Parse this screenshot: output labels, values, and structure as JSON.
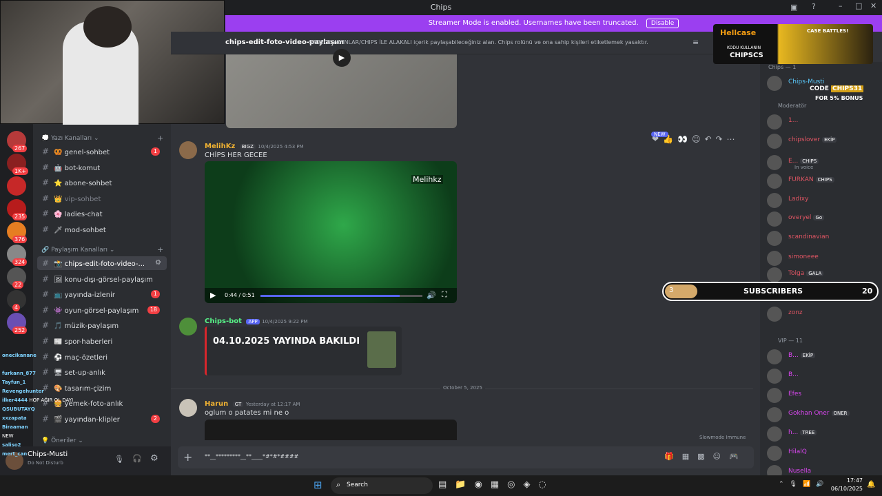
{
  "window": {
    "title": "Chips"
  },
  "banner": {
    "text": "Streamer Mode is enabled. Usernames have been truncated.",
    "button": "Disable"
  },
  "channel": {
    "name": "chips-edit-foto-video-paylaşım",
    "topic": "SADECE YAYINLAR/CHIPS İLE ALAKALI içerik paylaşabileceğiniz alan. Chips rolünü ve ona sahip kişileri etiketlemek yasaktır."
  },
  "servers": [
    {
      "badge": "267"
    },
    {
      "badge": "1K+"
    },
    {
      "badge": ""
    },
    {
      "badge": "235"
    },
    {
      "badge": "376"
    },
    {
      "badge": "324"
    },
    {
      "badge": "22"
    },
    {
      "badge": "4"
    },
    {
      "badge": "252"
    }
  ],
  "categories": {
    "text": "Yazı Kanalları",
    "share": "Paylaşım Kanalları",
    "suggest": "Öneriler"
  },
  "channels": [
    {
      "name": "genel-sohbet",
      "icon": "🥨",
      "badge": "1",
      "muted": false,
      "selected": false
    },
    {
      "name": "bot-komut",
      "icon": "🤖",
      "badge": "",
      "muted": false,
      "selected": false
    },
    {
      "name": "abone-sohbet",
      "icon": "⭐",
      "badge": "",
      "muted": false,
      "selected": false
    },
    {
      "name": "vip-sohbet",
      "icon": "👑",
      "badge": "",
      "muted": true,
      "selected": false
    },
    {
      "name": "ladies-chat",
      "icon": "🌸",
      "badge": "",
      "muted": false,
      "selected": false
    },
    {
      "name": "mod-sohbet",
      "icon": "🗡",
      "badge": "",
      "muted": false,
      "selected": false
    },
    {
      "name": "chips-edit-foto-video-...",
      "icon": "📸",
      "badge": "",
      "muted": false,
      "selected": true
    },
    {
      "name": "konu-dışı-görsel-paylaşım",
      "icon": "🖼",
      "badge": "",
      "muted": false,
      "selected": false
    },
    {
      "name": "yayında-izlenir",
      "icon": "📺",
      "badge": "1",
      "muted": false,
      "selected": false
    },
    {
      "name": "oyun-görsel-paylaşım",
      "icon": "👾",
      "badge": "18",
      "muted": false,
      "selected": false
    },
    {
      "name": "müzik-paylaşım",
      "icon": "🎵",
      "badge": "",
      "muted": false,
      "selected": false
    },
    {
      "name": "spor-haberleri",
      "icon": "📰",
      "badge": "",
      "muted": false,
      "selected": false
    },
    {
      "name": "maç-özetleri",
      "icon": "⚽",
      "badge": "",
      "muted": false,
      "selected": false
    },
    {
      "name": "set-up-anlık",
      "icon": "🖥",
      "badge": "",
      "muted": false,
      "selected": false
    },
    {
      "name": "tasarım-çizim",
      "icon": "🎨",
      "badge": "",
      "muted": false,
      "selected": false
    },
    {
      "name": "yemek-foto-anlık",
      "icon": "🍔",
      "badge": "",
      "muted": false,
      "selected": false
    },
    {
      "name": "yayından-klipler",
      "icon": "🎬",
      "badge": "2",
      "muted": false,
      "selected": false
    }
  ],
  "user": {
    "name": "Chips-Musti",
    "status": "Do Not Disturb"
  },
  "messages": [
    {
      "author": "MelihKz",
      "tag": "BIGZ",
      "time": "10/4/2025 4:53 PM",
      "text": "CHİPS HER GECEE",
      "video_overlay": "Melihkz",
      "video_time": "0:44 / 0:51",
      "video_progress": 0.86,
      "reactions_new": "NEW"
    },
    {
      "author": "Chips-bot",
      "tag": "APP",
      "time": "10/4/2025 9:22 PM",
      "embed_title": "04.10.2025 YAYINDA BAKILDI"
    },
    {
      "divider": "October 5, 2025"
    },
    {
      "author": "Harun",
      "tag": "GT",
      "time": "Yesterday at 12:17 AM",
      "text": "oglum o patates mi ne o"
    }
  ],
  "composer": {
    "placeholder": "**__*********__**____*#*#*####",
    "slowmode": "Slowmode Immune"
  },
  "members": {
    "chips_header": "Chips — 1",
    "mod_header": "Moderatör",
    "vip_header": "VIP — 11",
    "list": [
      {
        "name": "Chips-Musti",
        "tag": "",
        "color": "#5ac8fa"
      },
      {
        "name": "1...",
        "tag": "",
        "color": "#e05563"
      },
      {
        "name": "chipslover",
        "tag": "EKİP",
        "color": "#e05563"
      },
      {
        "name": "E...",
        "tag": "CHIPS",
        "color": "#e05563",
        "sub": "In voice"
      },
      {
        "name": "FURKAN",
        "tag": "CHIPS",
        "color": "#e05563"
      },
      {
        "name": "Ladixy",
        "tag": "",
        "color": "#e05563"
      },
      {
        "name": "overyel",
        "tag": "Go",
        "color": "#e05563"
      },
      {
        "name": "scandinavian",
        "tag": "",
        "color": "#e05563"
      },
      {
        "name": "simoneee",
        "tag": "",
        "color": "#e05563"
      },
      {
        "name": "Tolga",
        "tag": "GALA",
        "color": "#e05563"
      },
      {
        "name": "zonz",
        "tag": "",
        "color": "#e05563"
      }
    ],
    "vip": [
      {
        "name": "B...",
        "tag": "EKİP",
        "color": "#d946ef"
      },
      {
        "name": "B...",
        "tag": "",
        "color": "#d946ef"
      },
      {
        "name": "Efes",
        "tag": "",
        "color": "#d946ef"
      },
      {
        "name": "Gokhan Oner",
        "tag": "ONER",
        "color": "#d946ef"
      },
      {
        "name": "h...",
        "tag": "TREE",
        "color": "#d946ef"
      },
      {
        "name": "HilalQ",
        "tag": "",
        "color": "#d946ef"
      },
      {
        "name": "Nusella",
        "tag": "",
        "color": "#d946ef"
      }
    ]
  },
  "ad": {
    "brand": "Hellcase",
    "line1": "KODU KULLANIN",
    "code": "CHIPSCS",
    "right": "CASE BATTLES!"
  },
  "ad2": {
    "code_label": "CODE",
    "code": "CHIPS31",
    "line": "FOR 5% BONUS"
  },
  "subs": {
    "count": "3",
    "label": "SUBSCRIBERS",
    "goal": "20",
    "progress": 0.15
  },
  "chat_overlay": [
    {
      "user": "onecikanane",
      "text": ""
    },
    {
      "user": "",
      "text": ""
    },
    {
      "user": "furkann_877",
      "text": ""
    },
    {
      "user": "Tayfun_1",
      "text": ""
    },
    {
      "user": "Revengehunter",
      "text": ""
    },
    {
      "user": "ilker4444",
      "text": "HOP AĞIR OL DAYI"
    },
    {
      "user": "QSUBUTAYQ",
      "text": ""
    },
    {
      "user": "xxzapata",
      "text": ""
    },
    {
      "user": "Biraaman",
      "text": ""
    },
    {
      "user": "",
      "text": "NEW"
    },
    {
      "user": "saliso2",
      "text": ""
    },
    {
      "user": "mert_can",
      "text": ""
    }
  ],
  "taskbar": {
    "search": "Search",
    "time": "17:47",
    "date": "06/10/2025"
  }
}
